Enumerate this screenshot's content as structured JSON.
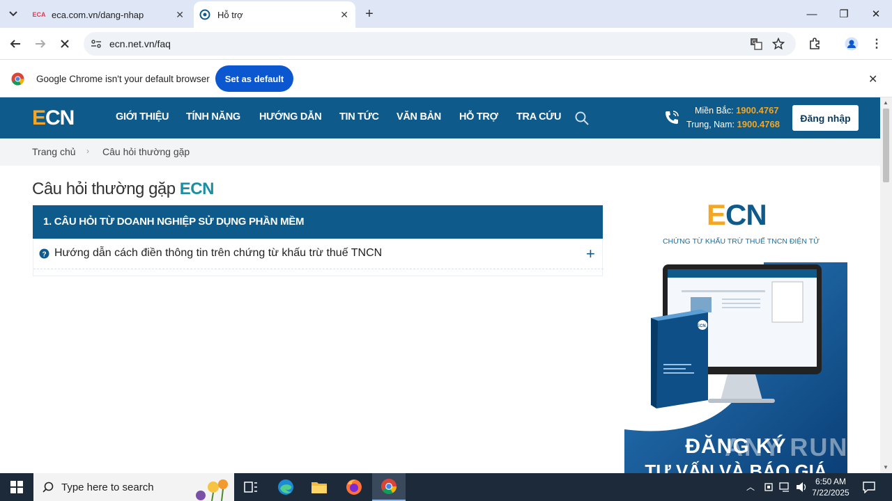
{
  "browser": {
    "tabs": [
      {
        "favicon": "ECA",
        "title": "eca.com.vn/dang-nhap"
      },
      {
        "title": "Hỗ trợ"
      }
    ],
    "url": "ecn.net.vn/faq",
    "infobar": {
      "message": "Google Chrome isn't your default browser",
      "button": "Set as default"
    }
  },
  "site": {
    "logo": {
      "e": "E",
      "cn": "CN"
    },
    "nav": [
      "GIỚI THIỆU",
      "TÍNH NĂNG",
      "HƯỚNG DẪN",
      "TIN TỨC",
      "VĂN BẢN",
      "HỖ TRỢ",
      "TRA CỨU"
    ],
    "hotline": {
      "north_label": "Miền Bắc:",
      "north_number": "1900.4767",
      "south_label": "Trung, Nam:",
      "south_number": "1900.4768"
    },
    "login": "Đăng nhập",
    "colors": {
      "brand_blue": "#0d5a8b",
      "accent_orange": "#f5a623",
      "teal": "#1b8ea3"
    }
  },
  "breadcrumb": {
    "home": "Trang chủ",
    "separator": "›",
    "current": "Câu hỏi thường gặp"
  },
  "page": {
    "title_main": "Câu hỏi thường gặp",
    "title_accent": "ECN",
    "section": "1. CÂU HỎI TỪ DOANH NGHIỆP SỬ DỤNG PHẦN MỀM",
    "questions": [
      {
        "icon": "question-circle-icon",
        "text": "Hướng dẫn cách điền thông tin trên chứng từ khấu trừ thuế TNCN",
        "toggle": "+"
      }
    ]
  },
  "ad": {
    "logo_e": "E",
    "logo_cn": "CN",
    "tagline": "CHỨNG TỪ KHẤU TRỪ THUẾ TNCN ĐIỆN TỬ",
    "box_logo": "ECN",
    "cta_line1": "ĐĂNG KÝ",
    "cta_line2": "TƯ VẤN VÀ BÁO GIÁ",
    "watermark": "ANY RUN"
  },
  "taskbar": {
    "search_placeholder": "Type here to search",
    "time": "6:50 AM",
    "date": "7/22/2025"
  }
}
